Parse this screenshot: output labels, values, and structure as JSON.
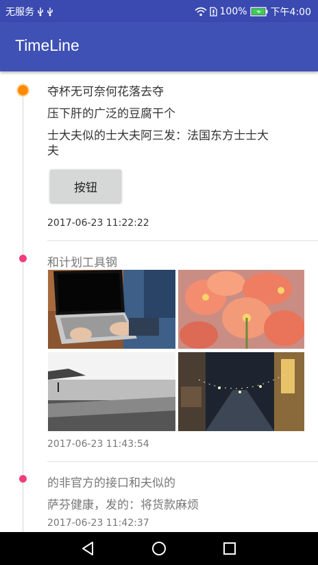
{
  "status_bar": {
    "carrier": "无服务",
    "battery": "100%",
    "time": "下午4:00"
  },
  "app_bar": {
    "title": "TimeLine"
  },
  "timeline": [
    {
      "dot_color": "#ff8a00",
      "lines": [
        "夺杯无可奈何花落去夺",
        "压下肝的广泛的豆腐干个",
        "士大夫似的士大夫阿三发：法国东方士士大",
        "夫"
      ],
      "button_label": "按钮",
      "timestamp": "2017-06-23 11:22:22"
    },
    {
      "dot_color": "#ef3f7a",
      "lines": [
        "和计划工具钢"
      ],
      "photos": [
        "laptop-photo",
        "flower-photo",
        "beach-photo",
        "street-photo"
      ],
      "timestamp": "2017-06-23 11:43:54"
    },
    {
      "dot_color": "#ef3f7a",
      "lines": [
        "的非官方的接口和夫似的",
        "萨芬健康，发的：将货款麻烦"
      ],
      "timestamp": "2017-06-23 11:42:37"
    }
  ],
  "nav": {
    "icons": [
      "back-icon",
      "home-icon",
      "recents-icon"
    ]
  },
  "colors": {
    "primary": "#3f51b5",
    "primary_dark": "#3a4ab0",
    "accent_orange": "#ff8a00",
    "accent_pink": "#ef3f7a"
  }
}
